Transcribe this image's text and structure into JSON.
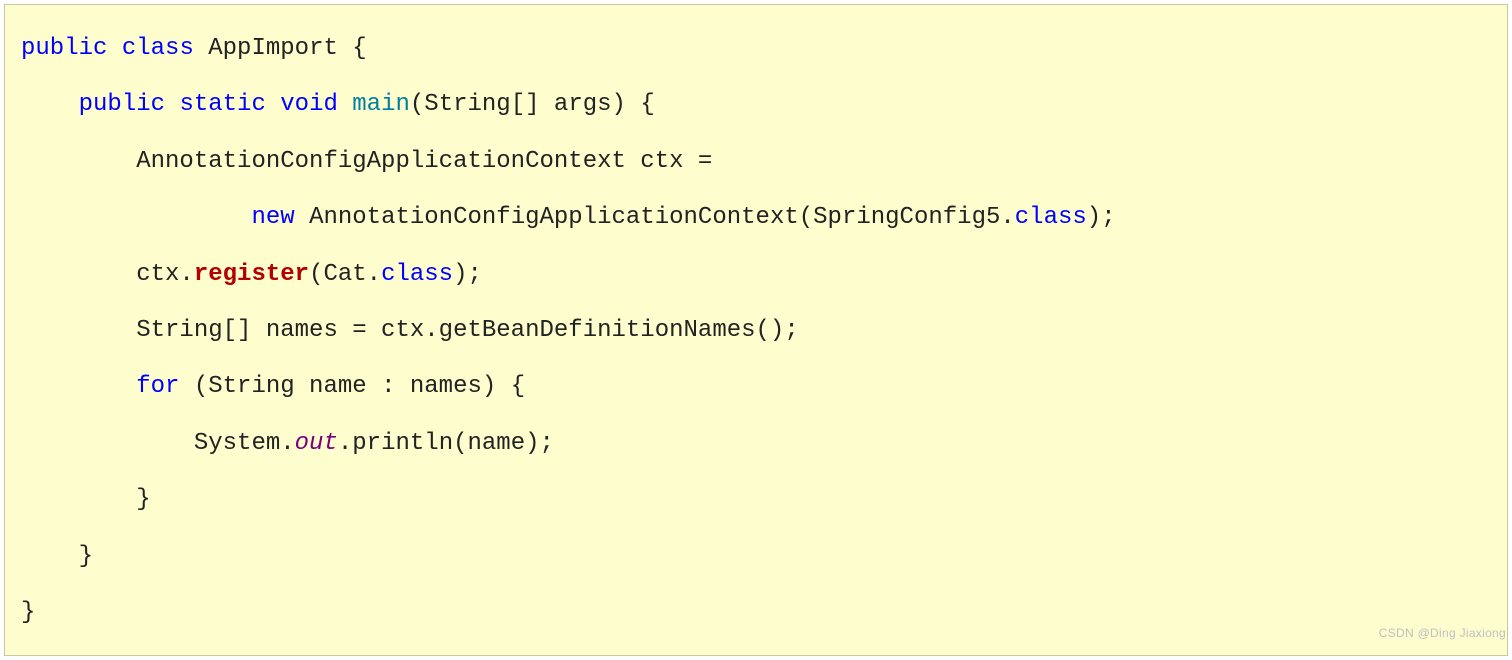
{
  "code": {
    "line1": {
      "kw1": "public",
      "kw2": "class",
      "class_name": "AppImport",
      "brace": "{"
    },
    "line2": {
      "kw1": "public",
      "kw2": "static",
      "kw3": "void",
      "method": "main",
      "params": "(String[] args) {"
    },
    "line3": {
      "text": "AnnotationConfigApplicationContext ctx ="
    },
    "line4": {
      "kw": "new",
      "ctor": "AnnotationConfigApplicationContext(SpringConfig5.",
      "cls": "class",
      "close": ");"
    },
    "line5": {
      "obj": "ctx.",
      "method": "register",
      "open": "(Cat.",
      "cls": "class",
      "close": ");"
    },
    "line6": {
      "text": "String[] names = ctx.getBeanDefinitionNames();"
    },
    "line7": {
      "kw": "for",
      "rest": " (String name : names) {"
    },
    "line8": {
      "sys": "System.",
      "out": "out",
      "rest": ".println(name);"
    },
    "line9": {
      "brace": "}"
    },
    "line10": {
      "brace": "}"
    },
    "line11": {
      "brace": "}"
    }
  },
  "watermark": "CSDN @Ding Jiaxiong"
}
